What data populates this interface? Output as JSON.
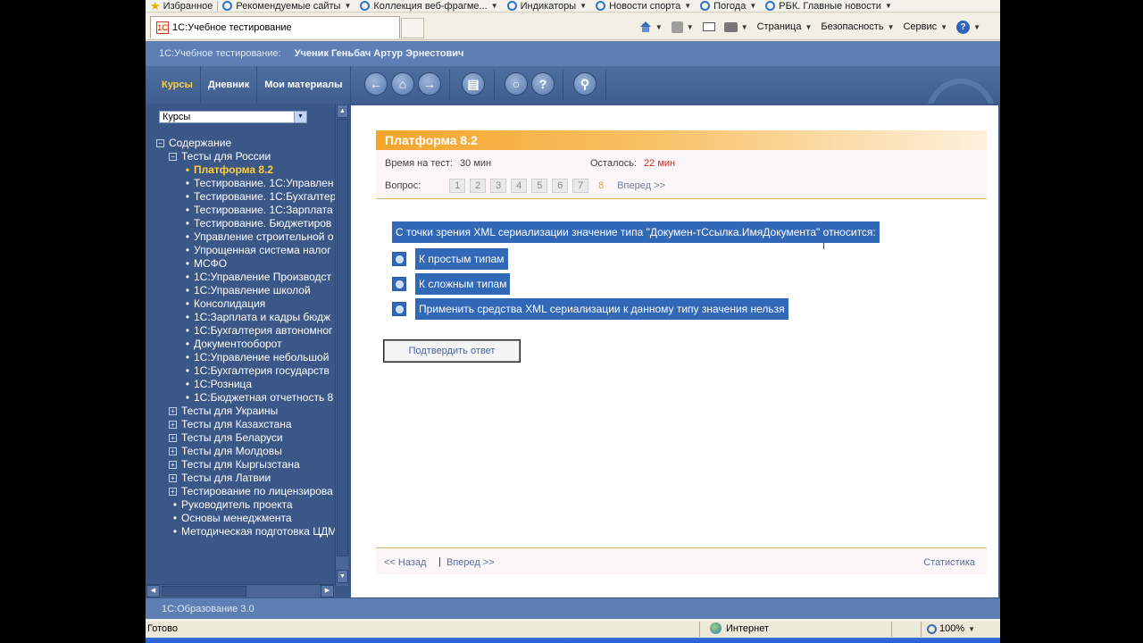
{
  "browser": {
    "favorites_bar": [
      "Избранное",
      "Рекомендуемые сайты",
      "Коллекция веб-фрагме...",
      "Индикаторы",
      "Новости спорта",
      "Погода",
      "РБК. Главные новости"
    ],
    "tab_title": "1С:Учебное тестирование",
    "commands": {
      "page": "Страница",
      "security": "Безопасность",
      "service": "Сервис"
    },
    "status_ready": "Готово",
    "zone": "Интернет",
    "zoom": "100%"
  },
  "app": {
    "title": "1С:Учебное тестирование:",
    "user": "Ученик Геньбач Артур Эрнестович",
    "nav": [
      "Курсы",
      "Дневник",
      "Мои материалы"
    ],
    "footer": "1С:Образование 3.0"
  },
  "sidebar": {
    "combo_value": "Курсы",
    "tree": [
      {
        "level": 0,
        "type": "minus",
        "label": "Содержание"
      },
      {
        "level": 1,
        "type": "minus",
        "label": "Тесты для России"
      },
      {
        "level": 2,
        "type": "bullet",
        "label": "Платформа 8.2",
        "selected": true
      },
      {
        "level": 2,
        "type": "bullet",
        "label": "Тестирование. 1С:Управлен"
      },
      {
        "level": 2,
        "type": "bullet",
        "label": "Тестирование. 1С:Бухгалтер"
      },
      {
        "level": 2,
        "type": "bullet",
        "label": "Тестирование. 1С:Зарплата"
      },
      {
        "level": 2,
        "type": "bullet",
        "label": "Тестирование. Бюджетиров"
      },
      {
        "level": 2,
        "type": "bullet",
        "label": "Управление строительной о"
      },
      {
        "level": 2,
        "type": "bullet",
        "label": "Упрощенная система налог"
      },
      {
        "level": 2,
        "type": "bullet",
        "label": "МСФО"
      },
      {
        "level": 2,
        "type": "bullet",
        "label": "1С:Управление Производст"
      },
      {
        "level": 2,
        "type": "bullet",
        "label": "1С:Управление школой"
      },
      {
        "level": 2,
        "type": "bullet",
        "label": "Консолидация"
      },
      {
        "level": 2,
        "type": "bullet",
        "label": "1С:Зарплата и кадры бюдж"
      },
      {
        "level": 2,
        "type": "bullet",
        "label": "1С:Бухгалтерия автономног"
      },
      {
        "level": 2,
        "type": "bullet",
        "label": "Документооборот"
      },
      {
        "level": 2,
        "type": "bullet",
        "label": "1С:Управление небольшой"
      },
      {
        "level": 2,
        "type": "bullet",
        "label": "1С:Бухгалтерия государств"
      },
      {
        "level": 2,
        "type": "bullet",
        "label": "1С:Розница"
      },
      {
        "level": 2,
        "type": "bullet",
        "label": "1С:Бюджетная отчетность 8"
      },
      {
        "level": 1,
        "type": "plus",
        "label": "Тесты для Украины"
      },
      {
        "level": 1,
        "type": "plus",
        "label": "Тесты для Казахстана"
      },
      {
        "level": 1,
        "type": "plus",
        "label": "Тесты для Беларуси"
      },
      {
        "level": 1,
        "type": "plus",
        "label": "Тесты для Молдовы"
      },
      {
        "level": 1,
        "type": "plus",
        "label": "Тесты для Кыргызстана"
      },
      {
        "level": 1,
        "type": "plus",
        "label": "Тесты для Латвии"
      },
      {
        "level": 1,
        "type": "plus",
        "label": "Тестирование по лицензирова"
      },
      {
        "level": 1,
        "type": "bullet",
        "label": "Руководитель проекта"
      },
      {
        "level": 1,
        "type": "bullet",
        "label": "Основы менеджмента"
      },
      {
        "level": 1,
        "type": "bullet",
        "label": "Методическая подготовка ЦДМ"
      }
    ]
  },
  "test": {
    "title": "Платформа 8.2",
    "time_label": "Время на тест:",
    "time_value": "30 мин",
    "remaining_label": "Осталось:",
    "remaining_value": "22 мин",
    "question_label": "Вопрос:",
    "question_numbers": [
      "1",
      "2",
      "3",
      "4",
      "5",
      "6",
      "7",
      "8"
    ],
    "current_question": "8",
    "next_link": "Вперед >>",
    "question_text": "С точки зрения XML сериализации значение типа \"Докумен-тСсылка.ИмяДокумента\" относится:",
    "answers": [
      "К простым типам",
      "К сложным типам",
      "Применить средства XML сериализации к данному типу значения нельзя"
    ],
    "confirm_label": "Подтвердить ответ",
    "footer_back": "<< Назад",
    "footer_sep": "|",
    "footer_next": "Вперед >>",
    "footer_stats": "Статистика"
  }
}
